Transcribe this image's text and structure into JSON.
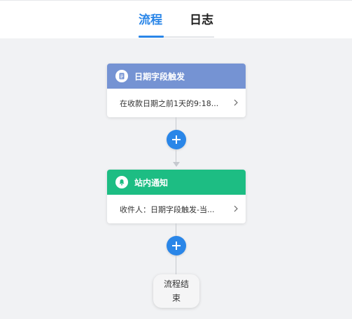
{
  "tabs": [
    {
      "label": "流程",
      "active": true
    },
    {
      "label": "日志",
      "active": false
    }
  ],
  "colors": {
    "accent": "#2a86e8",
    "trigger_header": "#7593d3",
    "notify_header": "#1dbd83",
    "connector": "#c6c9cf",
    "background": "#f1f2f4"
  },
  "flow": {
    "trigger": {
      "icon": "document-icon",
      "title": "日期字段触发",
      "summary": "在收款日期之前1天的9:18..."
    },
    "add_button_icon": "plus-icon",
    "notify": {
      "icon": "bell-icon",
      "title": "站内通知",
      "summary": "收件人：日期字段触发-当..."
    },
    "end": {
      "label": "流程结束"
    }
  }
}
